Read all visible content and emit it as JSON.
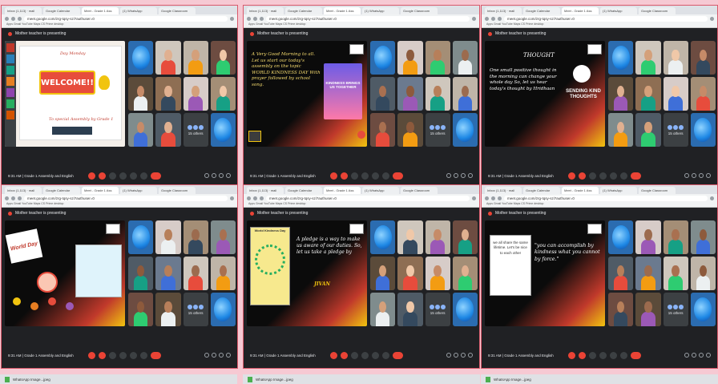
{
  "browser": {
    "url": "meet.google.com/zrg-tqsy-szi?authuser=0",
    "tabs": [
      "Inbox (1,113) · mail",
      "Google Calendar",
      "Meet - Grade 1 Ass",
      "(1) WhatsApp",
      "Google Classroom"
    ],
    "bookmarks": "Apps   Gmail   YouTube   Maps   CS Prime desktop"
  },
  "meet": {
    "presenting": "Mother teacher is presenting",
    "others_label": "15 others"
  },
  "panels": [
    {
      "time": "9:31 AM",
      "meeting": "Grade 1 Assembly and English",
      "slide_theme": "welcome",
      "slide": {
        "title": "WELCOME!!",
        "subtitle": "To special Assembly by Grade 1",
        "heading": "Day Monday"
      }
    },
    {
      "time": "9:31 AM",
      "meeting": "Grade 1 Assembly and English",
      "slide_theme": "kindness",
      "slide": {
        "text": "A Very Good Morning to all. Let us start our today's assembly on the topic WORLD KINDNESS DAY With prayer followed by school song.",
        "card": "KINDNESS BRINGS US TOGETHER"
      }
    },
    {
      "time": "9:31 AM",
      "meeting": "Grade 1 Assembly and English",
      "slide_theme": "thought",
      "slide": {
        "heading": "THOUGHT",
        "text": "One small positive thought in the morning can change your whole day So, let us hear today's thought by Hridhaan",
        "sticker": "SENDING KIND THOUGHTS"
      }
    },
    {
      "time": "9:31 AM",
      "meeting": "Grade 1 Assembly and English",
      "slide_theme": "worldday",
      "slide": {
        "badge": "World Day"
      }
    },
    {
      "time": "9:31 AM",
      "meeting": "Grade 1 Assembly and English",
      "slide_theme": "pledge",
      "slide": {
        "card_title": "World Kindness Day",
        "text": "A pledge is a way to make us aware of our duties. So, let us take a pledge by",
        "name": "JIVAN"
      }
    },
    {
      "time": "9:31 AM",
      "meeting": "Grade 1 Assembly and English",
      "slide_theme": "quote",
      "slide": {
        "card": "we all share the same lifetime. Let's be nice to each other",
        "quote": "\"you can accomplish by kindness what you cannot by force.\""
      }
    }
  ],
  "taskbar": {
    "file": "WhatsApp Image...jpeg"
  }
}
